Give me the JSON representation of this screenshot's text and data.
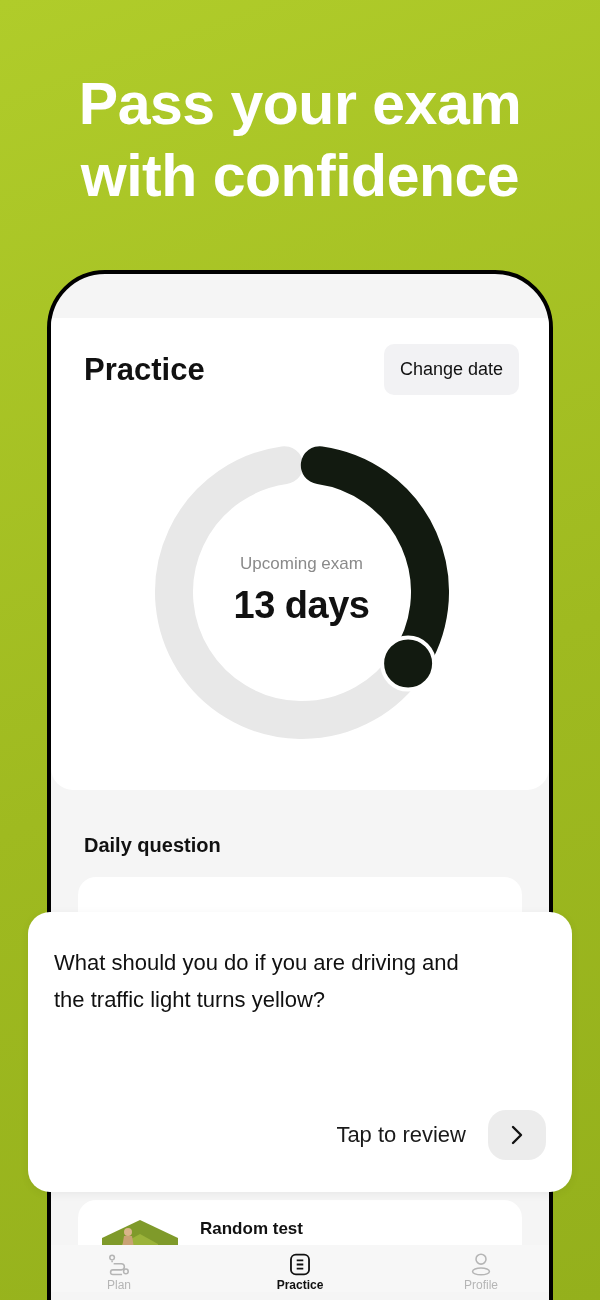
{
  "headline": "Pass your exam with confidence",
  "screen": {
    "title": "Practice",
    "change_date": "Change date",
    "countdown": {
      "label": "Upcoming exam",
      "value": "13 days"
    },
    "daily_question": {
      "heading": "Daily question",
      "question": "What should you do if you are driving and the traffic light turns yellow?",
      "action": "Tap to review"
    },
    "random_test": {
      "title": "Random test"
    }
  },
  "tab_bar": [
    {
      "label": "Plan",
      "selected": false
    },
    {
      "label": "Practice",
      "selected": true
    },
    {
      "label": "Profile",
      "selected": false
    }
  ]
}
